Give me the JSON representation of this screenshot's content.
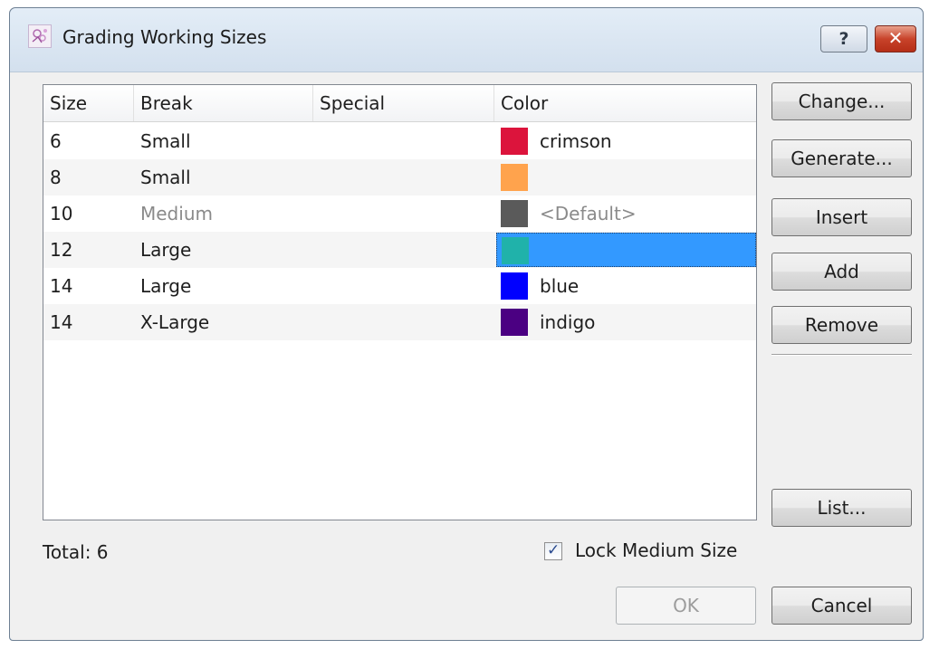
{
  "window": {
    "title": "Grading Working Sizes",
    "help_label": "?",
    "close_label": "✕"
  },
  "table": {
    "columns": [
      "Size",
      "Break",
      "Special",
      "Color"
    ],
    "rows": [
      {
        "size": "6",
        "break": "Small",
        "special": "",
        "color_hex": "#dc143c",
        "color_name": "crimson"
      },
      {
        "size": "8",
        "break": "Small",
        "special": "",
        "color_hex": "#ffa34d",
        "color_name": ""
      },
      {
        "size": "10",
        "break": "Medium",
        "special": "",
        "color_hex": "#5a5a5a",
        "color_name": "<Default>"
      },
      {
        "size": "12",
        "break": "Large",
        "special": "",
        "color_hex": "#20b2aa",
        "color_name": ""
      },
      {
        "size": "14",
        "break": "Large",
        "special": "",
        "color_hex": "#0000ff",
        "color_name": "blue"
      },
      {
        "size": "14",
        "break": "X-Large",
        "special": "",
        "color_hex": "#4b0082",
        "color_name": "indigo"
      }
    ]
  },
  "buttons": {
    "change": "Change...",
    "generate": "Generate...",
    "insert": "Insert",
    "add": "Add",
    "remove": "Remove",
    "list": "List...",
    "ok": "OK",
    "cancel": "Cancel"
  },
  "footer": {
    "total_label": "Total: 6",
    "lock_label": "Lock Medium Size",
    "lock_checked": true
  },
  "colors": {
    "selection": "#3399ff",
    "titlebar": "#d8e4f0"
  }
}
